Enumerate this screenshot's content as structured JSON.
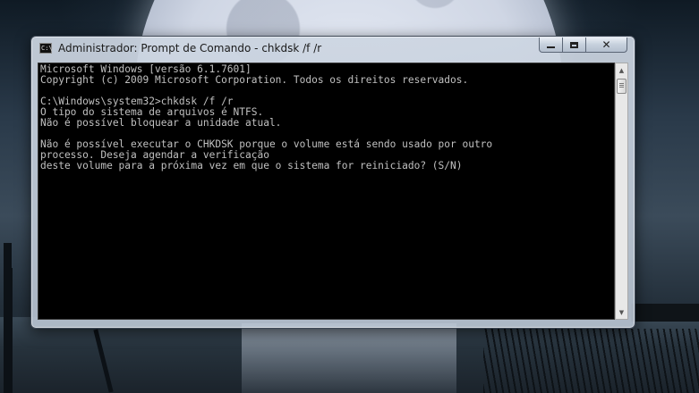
{
  "window": {
    "title": "Administrador: Prompt de Comando - chkdsk  /f /r",
    "app_icon_glyph": "C:\\",
    "icons": {
      "app": "command-prompt-icon",
      "minimize": "minimize-icon",
      "maximize": "maximize-icon",
      "close": "close-icon"
    },
    "close_glyph": "✕"
  },
  "console": {
    "background_color": "#000000",
    "text_color": "#c0c0c0",
    "lines": [
      "Microsoft Windows [versão 6.1.7601]",
      "Copyright (c) 2009 Microsoft Corporation. Todos os direitos reservados.",
      "",
      "C:\\Windows\\system32>chkdsk /f /r",
      "O tipo do sistema de arquivos é NTFS.",
      "Não é possível bloquear a unidade atual.",
      "",
      "Não é possível executar o CHKDSK porque o volume está sendo usado por outro",
      "processo. Deseja agendar a verificação",
      "deste volume para a próxima vez em que o sistema for reiniciado? (S/N)"
    ]
  },
  "scrollbar": {
    "up_glyph": "▲",
    "down_glyph": "▼"
  }
}
